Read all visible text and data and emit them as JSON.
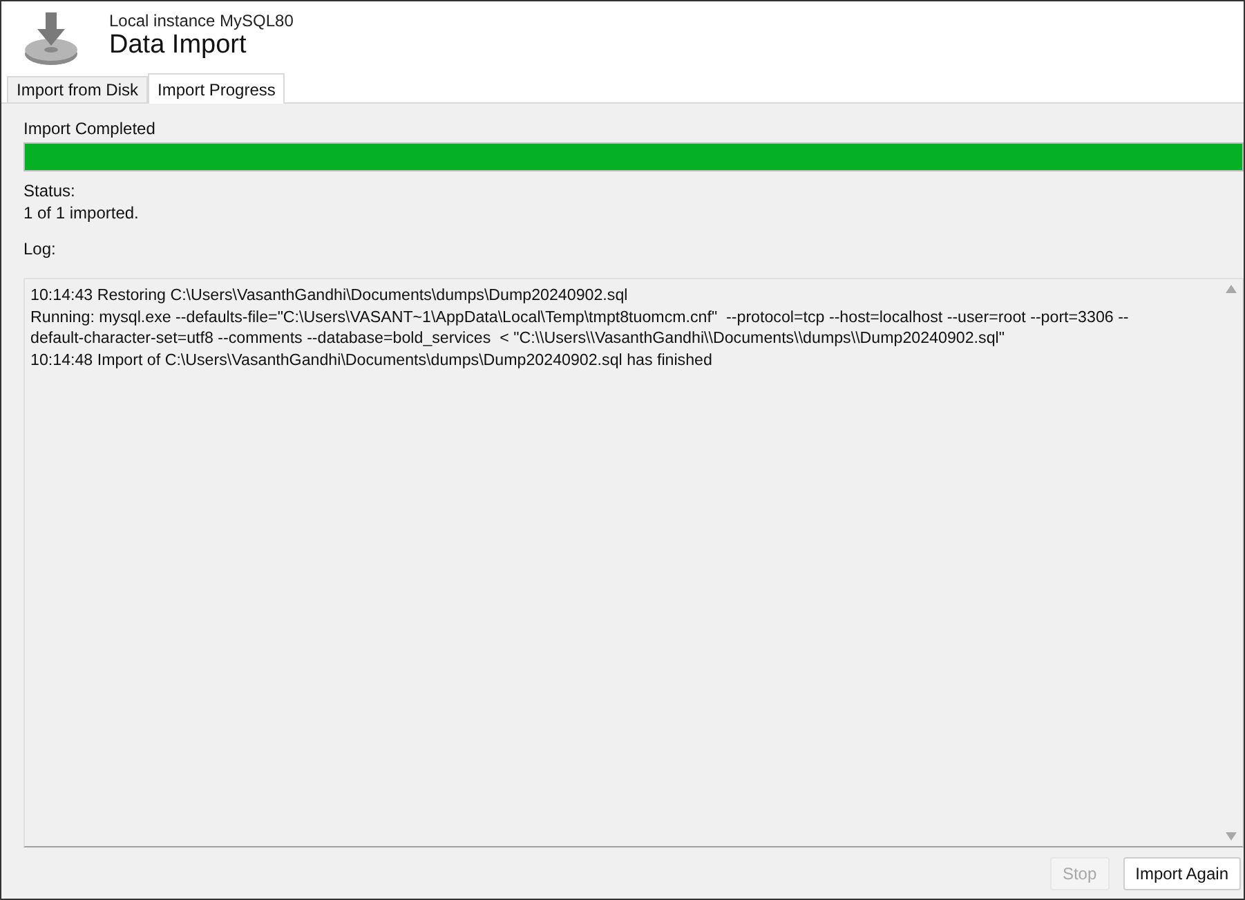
{
  "header": {
    "subtitle": "Local instance MySQL80",
    "title": "Data Import"
  },
  "tabs": [
    {
      "label": "Import from Disk",
      "selected": false
    },
    {
      "label": "Import Progress",
      "selected": true
    }
  ],
  "progress": {
    "label": "Import Completed",
    "level": 1
  },
  "status": {
    "label": "Status:",
    "value": "1 of 1 imported."
  },
  "log": {
    "label": "Log:",
    "lines": [
      "10:14:43 Restoring C:\\Users\\VasanthGandhi\\Documents\\dumps\\Dump20240902.sql",
      "Running: mysql.exe --defaults-file=\"C:\\Users\\VASANT~1\\AppData\\Local\\Temp\\tmpt8tuomcm.cnf\"  --protocol=tcp --host=localhost --user=root --port=3306 --",
      "default-character-set=utf8 --comments --database=bold_services  < \"C:\\\\Users\\\\VasanthGandhi\\\\Documents\\\\dumps\\\\Dump20240902.sql\"",
      "10:14:48 Import of C:\\Users\\VasanthGandhi\\Documents\\dumps\\Dump20240902.sql has finished"
    ]
  },
  "buttons": [
    {
      "label": "Stop",
      "disabled": true
    },
    {
      "label": "Import Again",
      "disabled": false
    }
  ]
}
